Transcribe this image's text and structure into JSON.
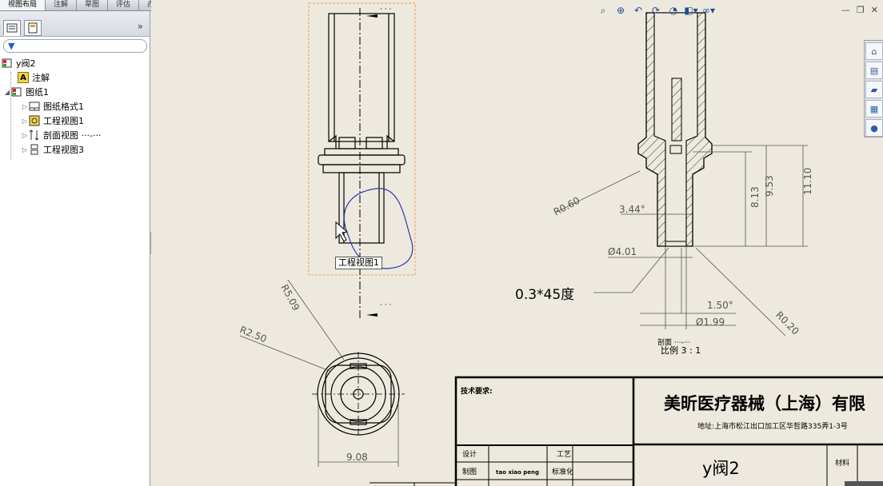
{
  "command_tabs": [
    "视图布局",
    "注解",
    "草图",
    "评估",
    "办公室产品"
  ],
  "tree": {
    "root": "y阀2",
    "items": [
      {
        "label": "注解"
      },
      {
        "label": "图纸1"
      },
      {
        "label": "图纸格式1"
      },
      {
        "label": "工程视图1"
      },
      {
        "label": "剖面视图 ···-···"
      },
      {
        "label": "工程视图3"
      }
    ]
  },
  "tooltip": "工程视图1",
  "dimensions": {
    "r060": "R0.60",
    "angle": "3.44°",
    "d813": "8.13",
    "d953": "9.53",
    "d1110": "11.10",
    "dia401": "Ø4.01",
    "chamfer": "0.3*45度",
    "d150": "1.50°",
    "dia199": "Ø1.99",
    "r020": "R0.20",
    "r509": "R5.09",
    "r250": "R2.50",
    "d908": "9.08"
  },
  "section_label": {
    "line1": "剖面 ···-···",
    "line2": "比例 3 : 1"
  },
  "title_block": {
    "tech_req": "技术要求:",
    "company": "美昕医疗器械（上海）有限",
    "address": "地址:上海市松江出口加工区华哲路335弄1-3号",
    "design": "设计",
    "process": "工艺",
    "draw": "制图",
    "drawer": "tao xiao peng",
    "standard": "标准化",
    "part_name": "y阀2",
    "material": "材料"
  },
  "colors": {
    "sheet": "#ede9de",
    "line": "#000000",
    "dim": "#555555",
    "selection": "#f0a040",
    "sketch": "#2a3ca8"
  }
}
